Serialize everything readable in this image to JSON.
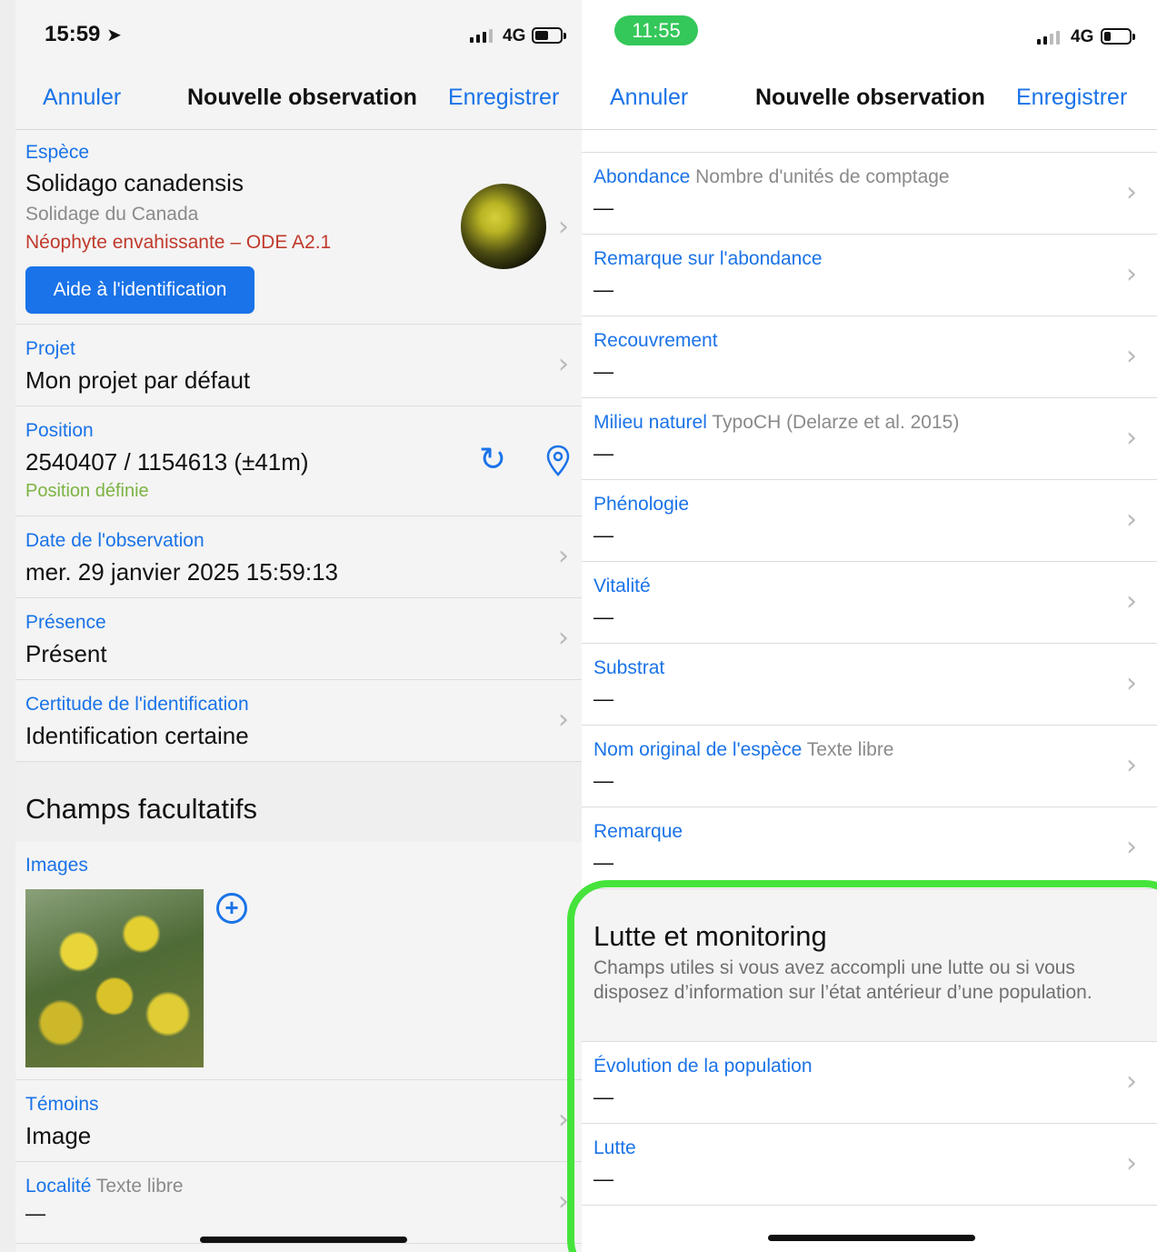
{
  "left_screen": {
    "status": {
      "time": "15:59",
      "network": "4G"
    },
    "nav": {
      "cancel": "Annuler",
      "title": "Nouvelle observation",
      "save": "Enregistrer"
    },
    "species": {
      "label": "Espèce",
      "latin_name": "Solidago canadensis",
      "common_name": "Solidage du Canada",
      "status": "Néophyte envahissante – ODE A2.1",
      "help_button": "Aide à l'identification"
    },
    "project": {
      "label": "Projet",
      "value": "Mon projet par défaut"
    },
    "position": {
      "label": "Position",
      "value": "2540407 / 1154613 (±41m)",
      "state": "Position définie"
    },
    "date": {
      "label": "Date de l'observation",
      "value": "mer. 29 janvier 2025 15:59:13"
    },
    "presence": {
      "label": "Présence",
      "value": "Présent"
    },
    "certainty": {
      "label": "Certitude de l'identification",
      "value": "Identification certaine"
    },
    "optional_title": "Champs facultatifs",
    "images": {
      "label": "Images"
    },
    "witnesses": {
      "label": "Témoins",
      "value": "Image"
    },
    "locality": {
      "label": "Localité",
      "hint": "Texte libre",
      "value": "—"
    }
  },
  "right_screen": {
    "status": {
      "time": "11:55",
      "network": "4G"
    },
    "nav": {
      "cancel": "Annuler",
      "title": "Nouvelle observation",
      "save": "Enregistrer"
    },
    "rows": [
      {
        "label": "Abondance",
        "hint": "Nombre d'unités de comptage",
        "value": "—"
      },
      {
        "label": "Remarque sur l'abondance",
        "hint": "",
        "value": "—"
      },
      {
        "label": "Recouvrement",
        "hint": "",
        "value": "—"
      },
      {
        "label": "Milieu naturel",
        "hint": "TypoCH (Delarze et al. 2015)",
        "value": "—"
      },
      {
        "label": "Phénologie",
        "hint": "",
        "value": "—"
      },
      {
        "label": "Vitalité",
        "hint": "",
        "value": "—"
      },
      {
        "label": "Substrat",
        "hint": "",
        "value": "—"
      },
      {
        "label": "Nom original de l'espèce",
        "hint": "Texte libre",
        "value": "—"
      },
      {
        "label": "Remarque",
        "hint": "",
        "value": "—"
      }
    ],
    "section": {
      "title": "Lutte et monitoring",
      "description": "Champs utiles si vous avez accompli une lutte ou si vous disposez d’information sur l’état antérieur d’une population."
    },
    "section_rows": [
      {
        "label": "Évolution de la population",
        "value": "—"
      },
      {
        "label": "Lutte",
        "value": "—"
      }
    ]
  },
  "colors": {
    "accent": "#1a73e8",
    "warning": "#c0392b",
    "success": "#7cb342",
    "highlight": "#46e33c"
  },
  "icons": [
    "location-arrow-icon",
    "refresh-icon",
    "map-pin-icon",
    "add-circle-icon",
    "chevron-right-icon",
    "signal-icon",
    "battery-icon"
  ]
}
